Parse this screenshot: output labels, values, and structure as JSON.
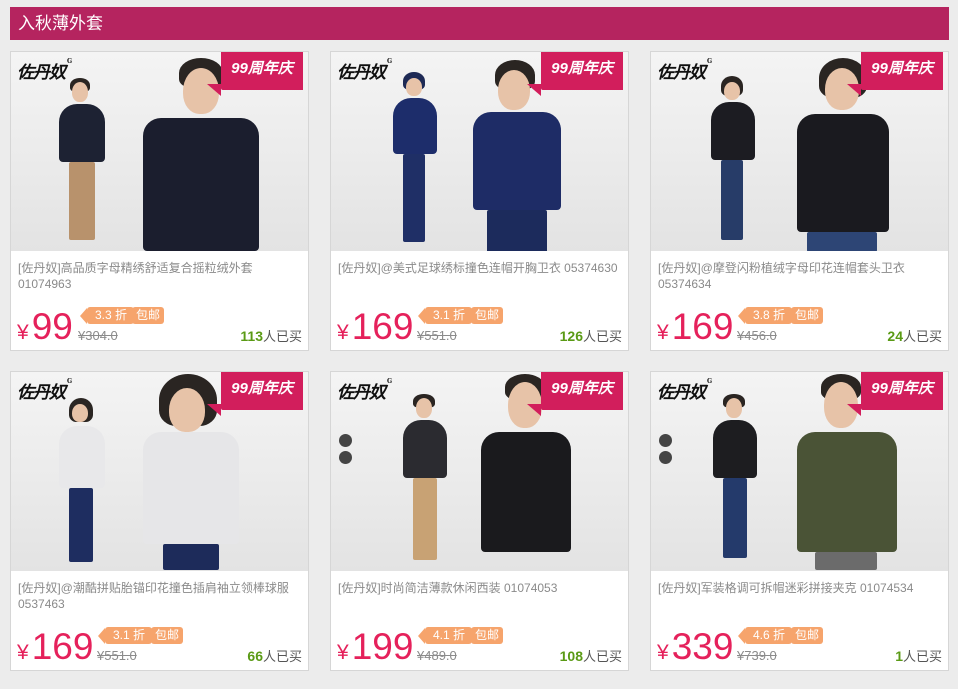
{
  "section_title": "入秋薄外套",
  "brand_logo": "佐丹奴",
  "badge": "99周年庆",
  "products": [
    {
      "title": "[佐丹奴]高品质字母精绣舒适复合摇粒绒外套 01074963",
      "currency": "¥",
      "price": "99",
      "discount": "3.3 折",
      "shipping": "包邮",
      "old_price": "¥304.0",
      "sold_count": "113",
      "sold_suffix": "人已买"
    },
    {
      "title": "[佐丹奴]@美式足球绣标撞色连帽开胸卫衣 05374630",
      "currency": "¥",
      "price": "169",
      "discount": "3.1 折",
      "shipping": "包邮",
      "old_price": "¥551.0",
      "sold_count": "126",
      "sold_suffix": "人已买"
    },
    {
      "title": "[佐丹奴]@摩登闪粉植绒字母印花连帽套头卫衣 05374634",
      "currency": "¥",
      "price": "169",
      "discount": "3.8 折",
      "shipping": "包邮",
      "old_price": "¥456.0",
      "sold_count": "24",
      "sold_suffix": "人已买"
    },
    {
      "title": "[佐丹奴]@潮酷拼贴胎锚印花撞色插肩袖立领棒球服 0537463",
      "currency": "¥",
      "price": "169",
      "discount": "3.1 折",
      "shipping": "包邮",
      "old_price": "¥551.0",
      "sold_count": "66",
      "sold_suffix": "人已买"
    },
    {
      "title": "[佐丹奴]时尚简洁薄款休闲西装 01074053",
      "currency": "¥",
      "price": "199",
      "discount": "4.1 折",
      "shipping": "包邮",
      "old_price": "¥489.0",
      "sold_count": "108",
      "sold_suffix": "人已买"
    },
    {
      "title": "[佐丹奴]军装格调可拆帽迷彩拼接夹克 01074534",
      "currency": "¥",
      "price": "339",
      "discount": "4.6 折",
      "shipping": "包邮",
      "old_price": "¥739.0",
      "sold_count": "1",
      "sold_suffix": "人已买"
    }
  ],
  "colors": {
    "header": "#b5245f",
    "price": "#e5215b",
    "tag": "#f6a46c",
    "sold": "#5a9a15",
    "badge": "#d21e5c"
  }
}
